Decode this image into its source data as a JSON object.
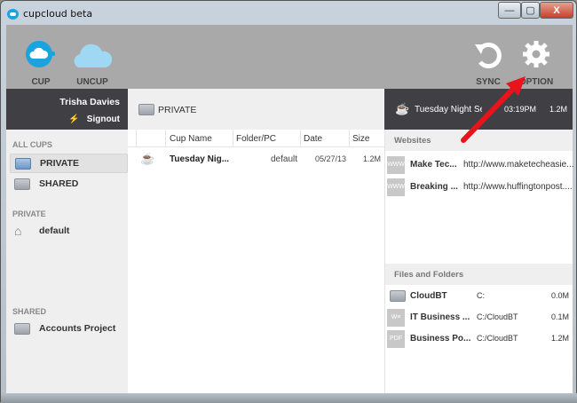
{
  "window": {
    "title": "cupcloud beta",
    "min": "—",
    "max": "▢",
    "close": "X"
  },
  "toolbar": {
    "cup": "CUP",
    "uncup": "UNCUP",
    "sync": "SYNC",
    "option": "OPTION"
  },
  "user": {
    "name": "Trisha Davies",
    "signout": "Signout"
  },
  "breadcrumb": "PRIVATE",
  "now_playing": {
    "name": "Tuesday Night Sessi",
    "time": "03:19PM",
    "size": "1.2M"
  },
  "sidebar": {
    "all_cups_heading": "ALL CUPS",
    "all_cups": [
      {
        "label": "PRIVATE"
      },
      {
        "label": "SHARED"
      }
    ],
    "private_heading": "PRIVATE",
    "private": [
      {
        "label": "default"
      }
    ],
    "shared_heading": "SHARED",
    "shared": [
      {
        "label": "Accounts Project"
      }
    ]
  },
  "table": {
    "headers": [
      "Cup Name",
      "Folder/PC",
      "Date",
      "Size"
    ],
    "rows": [
      {
        "name": "Tuesday Nig...",
        "folder": "default",
        "date": "05/27/13",
        "size": "1.2M"
      }
    ]
  },
  "websites": {
    "heading": "Websites",
    "items": [
      {
        "icon": "WWW",
        "name": "Make Tec...",
        "url": "http://www.maketecheasie..."
      },
      {
        "icon": "WWW",
        "name": "Breaking ...",
        "url": "http://www.huffingtonpost...."
      }
    ]
  },
  "files": {
    "heading": "Files and Folders",
    "items": [
      {
        "name": "CloudBT",
        "path": "C:",
        "size": "0.0M"
      },
      {
        "name": "IT Business ...",
        "path": "C:/CloudBT",
        "size": "0.1M"
      },
      {
        "name": "Business Po...",
        "path": "C:/CloudBT",
        "size": "1.2M"
      }
    ]
  },
  "colors": {
    "accent": "#1aa3de",
    "arrow": "#e8141c"
  }
}
